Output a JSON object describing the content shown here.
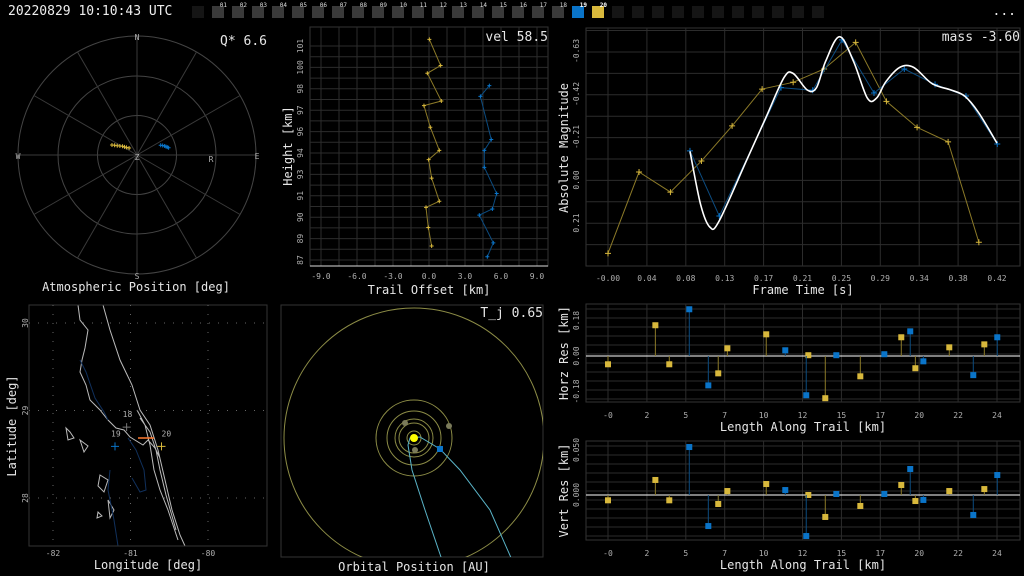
{
  "header": {
    "timestamp": "20220829 10:10:43 UTC",
    "more_label": "...",
    "stations": [
      {
        "label": "",
        "state": "empty"
      },
      {
        "label": "01"
      },
      {
        "label": "02"
      },
      {
        "label": "03"
      },
      {
        "label": "04"
      },
      {
        "label": "05"
      },
      {
        "label": "06"
      },
      {
        "label": "07"
      },
      {
        "label": "08"
      },
      {
        "label": "09"
      },
      {
        "label": "10"
      },
      {
        "label": "11"
      },
      {
        "label": "12"
      },
      {
        "label": "13"
      },
      {
        "label": "14"
      },
      {
        "label": "15"
      },
      {
        "label": "16"
      },
      {
        "label": "17"
      },
      {
        "label": "18"
      },
      {
        "label": "19",
        "state": "blue"
      },
      {
        "label": "20",
        "state": "yellow"
      },
      {
        "label": "",
        "state": "empty"
      },
      {
        "label": "",
        "state": "empty"
      },
      {
        "label": "",
        "state": "empty"
      },
      {
        "label": "",
        "state": "empty"
      },
      {
        "label": "",
        "state": "empty"
      },
      {
        "label": "",
        "state": "empty"
      },
      {
        "label": "",
        "state": "empty"
      },
      {
        "label": "",
        "state": "empty"
      },
      {
        "label": "",
        "state": "empty"
      },
      {
        "label": "",
        "state": "empty"
      },
      {
        "label": "",
        "state": "empty"
      }
    ]
  },
  "colors": {
    "yellow": "#d8b83c",
    "yellow_line": "#8c7a28",
    "blue": "#0a74c8",
    "blue_line": "#0c4c80",
    "grid": "#2c2c2c",
    "fit": "#ffffff",
    "orbit": "#c8c864",
    "traj": "#5ab4c8"
  },
  "chart_data": [
    {
      "id": "atmospheric",
      "type": "scatter",
      "title": "Atmospheric Position [deg]",
      "annotation": "Q*  6.6",
      "compass": {
        "n": "N",
        "s": "S",
        "e": "E",
        "w": "W",
        "zenith": "Z",
        "radiant": "R"
      },
      "rings_deg": [
        30,
        60,
        90
      ],
      "series": [
        {
          "name": "20",
          "east_deg": [
            -19,
            -17,
            -15,
            -13,
            -11,
            -9.5,
            -8,
            -6
          ],
          "north_deg": [
            7.6,
            7.4,
            7,
            6.8,
            6.6,
            6.2,
            5.8,
            5.3
          ]
        },
        {
          "name": "19",
          "east_deg": [
            18,
            19.5,
            21,
            22,
            23,
            24
          ],
          "north_deg": [
            7.4,
            7.2,
            6.8,
            6.4,
            6,
            5.5
          ]
        }
      ]
    },
    {
      "id": "height",
      "type": "line",
      "annotation": "vel 58.5",
      "xlabel": "Trail Offset [km]",
      "ylabel": "Height [km]",
      "xlim": [
        -9.9,
        9.9
      ],
      "ylim": [
        86.9,
        102.4
      ],
      "xticks": [
        "-9.0",
        "-6.0",
        "-3.0",
        "0.0",
        "3.0",
        "6.0",
        "9.0"
      ],
      "xtick_values": [
        -9,
        -6,
        -3,
        0,
        3,
        6,
        9
      ],
      "yticks": [
        "101",
        "100",
        "98",
        "97",
        "96",
        "94",
        "93",
        "91",
        "90",
        "89",
        "87"
      ],
      "series": [
        {
          "name": "20",
          "x": [
            0.03,
            0.97,
            -0.14,
            1.03,
            -0.42,
            0.11,
            0.86,
            -0.03,
            0.22,
            0.86,
            -0.25,
            -0.06,
            0.22
          ],
          "y": [
            101.6,
            99.9,
            99.4,
            97.6,
            97.3,
            95.9,
            94.4,
            93.8,
            92.6,
            91.1,
            90.7,
            89.4,
            88.2
          ]
        },
        {
          "name": "19",
          "x": [
            5.03,
            4.28,
            5.19,
            4.61,
            4.61,
            5.64,
            5.28,
            4.19,
            5.36,
            4.86
          ],
          "y": [
            98.6,
            97.9,
            95.1,
            94.4,
            93.3,
            91.6,
            90.6,
            90.2,
            88.4,
            87.5
          ]
        }
      ]
    },
    {
      "id": "magnitude",
      "type": "line",
      "annotation": "mass -3.60",
      "xlabel": "Frame Time [s]",
      "ylabel": "Absolute Magnitude",
      "xlim": [
        -0.024,
        0.445
      ],
      "ylim": [
        0.42,
        -0.742
      ],
      "xticks": [
        "-0.00",
        "0.04",
        "0.08",
        "0.13",
        "0.17",
        "0.21",
        "0.25",
        "0.29",
        "0.34",
        "0.38",
        "0.42"
      ],
      "yticks": [
        "-0.63",
        "-0.42",
        "-0.21",
        "0.00",
        "0.21"
      ],
      "ytick_values": [
        -0.63,
        -0.42,
        -0.21,
        0.0,
        0.21
      ],
      "series": [
        {
          "name": "20",
          "x": [
            0,
            0.0335,
            0.0674,
            0.1009,
            0.134,
            0.1664,
            0.1999,
            0.2333,
            0.2674,
            0.3006,
            0.3337,
            0.3672,
            0.4004
          ],
          "y": [
            0.358,
            -0.039,
            0.059,
            -0.093,
            -0.264,
            -0.444,
            -0.477,
            -0.542,
            -0.672,
            -0.384,
            -0.257,
            -0.186,
            0.304
          ]
        },
        {
          "name": "19",
          "x": [
            0.0885,
            0.1202,
            0.1868,
            0.221,
            0.2527,
            0.2872,
            0.3199,
            0.3531,
            0.3865,
            0.4203
          ],
          "y": [
            -0.142,
            0.176,
            -0.451,
            -0.438,
            -0.684,
            -0.425,
            -0.542,
            -0.467,
            -0.41,
            -0.176
          ]
        },
        {
          "name": "fit",
          "x": [
            0.0885,
            0.1,
            0.11,
            0.12,
            0.15,
            0.17,
            0.19,
            0.2,
            0.215,
            0.225,
            0.235,
            0.25,
            0.265,
            0.28,
            0.29,
            0.3,
            0.315,
            0.33,
            0.35,
            0.37,
            0.385,
            0.4,
            0.42
          ],
          "y": [
            -0.14,
            0.12,
            0.23,
            0.2,
            -0.1,
            -0.3,
            -0.5,
            -0.52,
            -0.44,
            -0.45,
            -0.58,
            -0.7,
            -0.58,
            -0.4,
            -0.4,
            -0.48,
            -0.55,
            -0.55,
            -0.47,
            -0.44,
            -0.41,
            -0.33,
            -0.18
          ]
        }
      ]
    },
    {
      "id": "horz_res",
      "type": "scatter",
      "xlabel": "Length Along Trail [km]",
      "ylabel": "Horz Res [km]",
      "xlim": [
        -1.37,
        25.7
      ],
      "ylim": [
        -0.233,
        0.264
      ],
      "xticks": [
        "-0",
        "2",
        "5",
        "7",
        "10",
        "12",
        "15",
        "17",
        "20",
        "22",
        "24"
      ],
      "yticks": [
        "0.18",
        "0.00",
        "-0.18"
      ],
      "ytick_values": [
        0.18,
        0,
        -0.18
      ],
      "series": [
        {
          "name": "20",
          "x": [
            0,
            2.96,
            3.83,
            6.89,
            7.46,
            9.89,
            12.52,
            13.58,
            15.77,
            18.33,
            19.21,
            21.33,
            23.52
          ],
          "y": [
            -0.042,
            0.156,
            -0.042,
            -0.088,
            0.039,
            0.11,
            0.004,
            -0.214,
            -0.103,
            0.095,
            -0.062,
            0.044,
            0.059
          ]
        },
        {
          "name": "19",
          "x": [
            5.08,
            6.27,
            11.08,
            12.39,
            14.27,
            17.27,
            18.89,
            19.71,
            22.83,
            24.33
          ],
          "y": [
            0.237,
            -0.149,
            0.029,
            -0.199,
            0.004,
            0.009,
            0.125,
            -0.027,
            -0.097,
            0.095
          ]
        }
      ]
    },
    {
      "id": "vert_res",
      "type": "scatter",
      "xlabel": "Length Along Trail [km]",
      "ylabel": "Vert Res [km]",
      "xlim": [
        -1.37,
        25.7
      ],
      "ylim": [
        -0.05,
        0.06
      ],
      "xticks": [
        "-0",
        "2",
        "5",
        "7",
        "10",
        "12",
        "15",
        "17",
        "20",
        "22",
        "24"
      ],
      "yticks": [
        "0.050",
        "0.000"
      ],
      "ytick_values": [
        0.05,
        0
      ],
      "series": [
        {
          "name": "20",
          "x": [
            0,
            2.96,
            3.83,
            6.89,
            7.46,
            9.89,
            12.52,
            13.58,
            15.77,
            18.33,
            19.21,
            21.33,
            23.52
          ],
          "y": [
            -0.0059,
            0.0167,
            -0.0059,
            -0.01,
            0.0044,
            0.0122,
            0,
            -0.0244,
            -0.0122,
            0.0111,
            -0.0067,
            0.0044,
            0.0066
          ]
        },
        {
          "name": "19",
          "x": [
            5.08,
            6.27,
            11.08,
            12.39,
            14.27,
            17.27,
            18.89,
            19.71,
            22.83,
            24.33
          ],
          "y": [
            0.0533,
            -0.0345,
            0.0055,
            -0.0456,
            0.0011,
            0.0011,
            0.0289,
            -0.0055,
            -0.0222,
            0.0222
          ]
        }
      ]
    },
    {
      "id": "map",
      "type": "scatter",
      "xlabel": "Longitude [deg]",
      "ylabel": "Latitude [deg]",
      "xticks": [
        "-82",
        "-81",
        "-80"
      ],
      "yticks": [
        "30",
        "29",
        "28"
      ],
      "markers": [
        {
          "label": "18",
          "lon": -81.05,
          "lat": 28.81,
          "color": "gray"
        },
        {
          "label": "19",
          "lon": -81.2,
          "lat": 28.59,
          "color": "blue"
        },
        {
          "label": "20",
          "lon": -80.6,
          "lat": 28.59,
          "color": "yellow"
        }
      ]
    },
    {
      "id": "orbit",
      "type": "scatter",
      "title": "Orbital Position [AU]",
      "annotation": "T_j 0.65"
    }
  ]
}
